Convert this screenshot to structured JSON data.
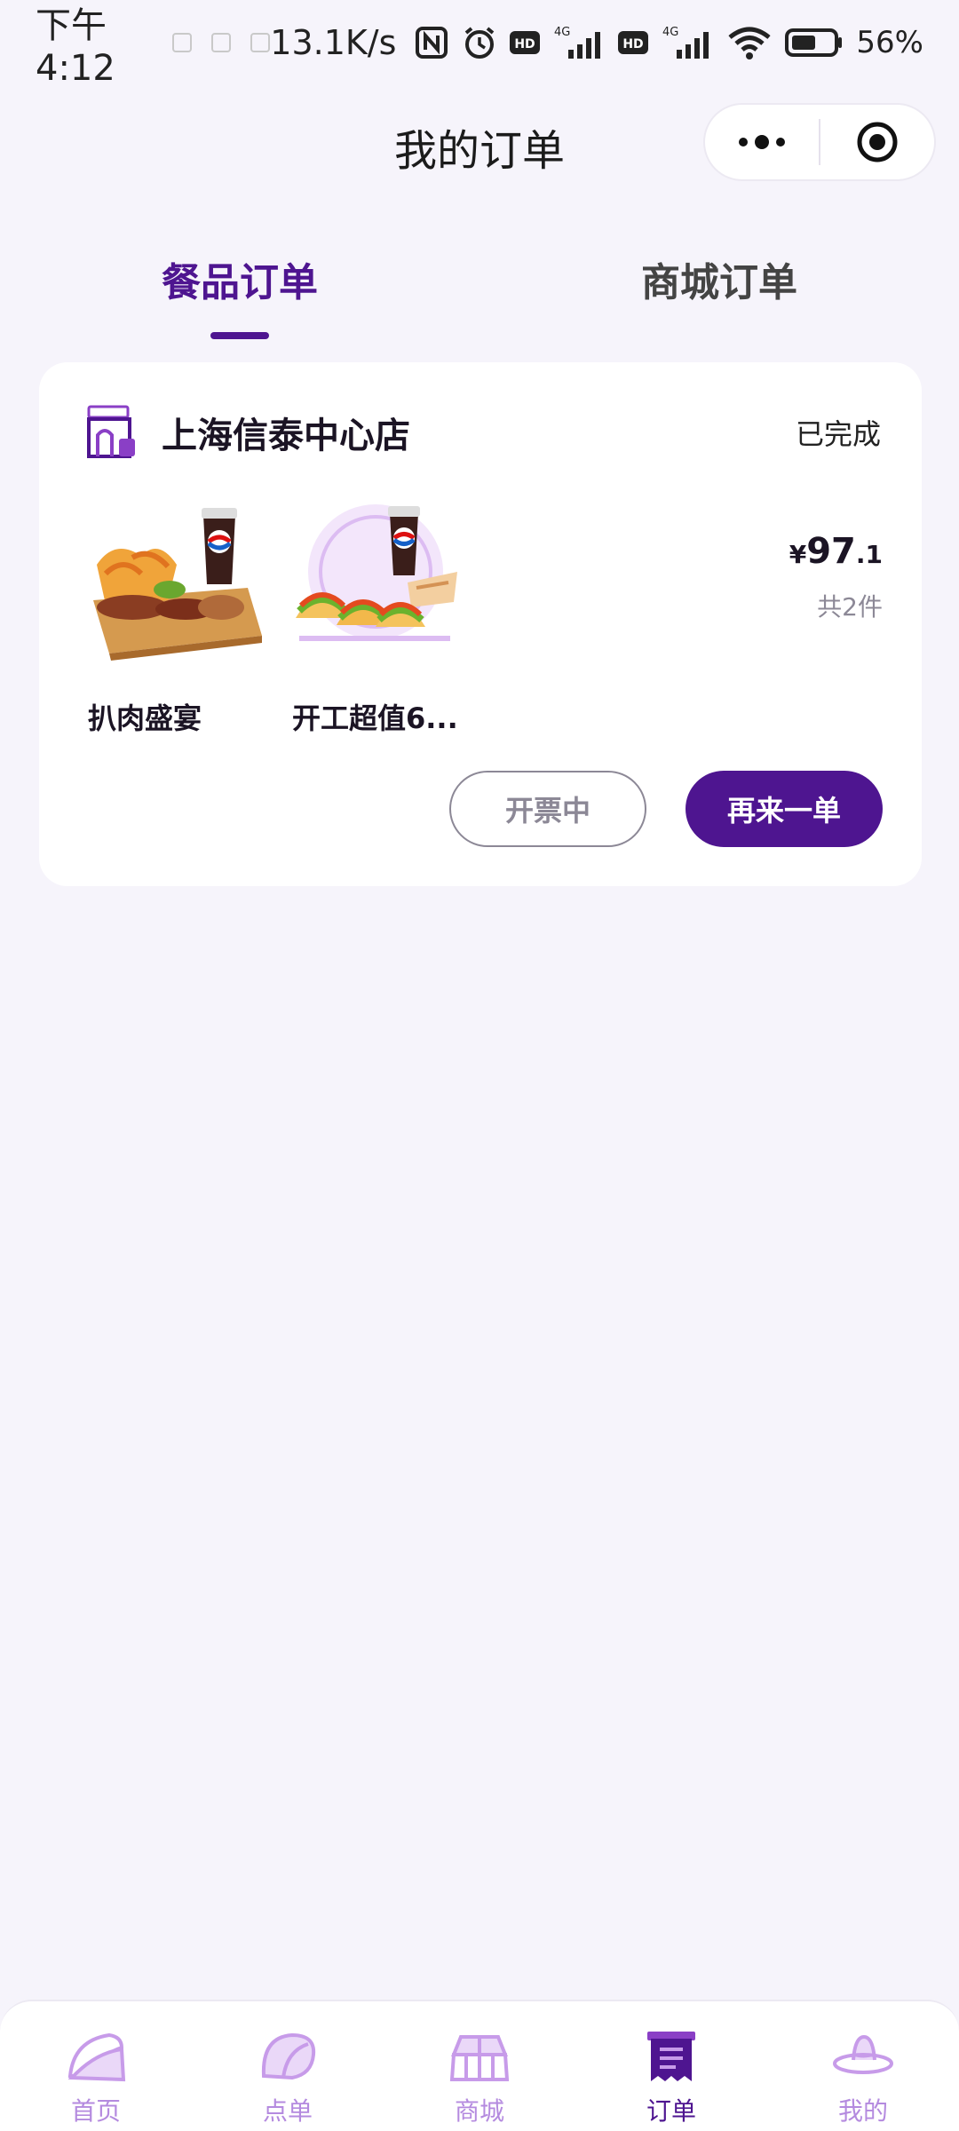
{
  "status_bar": {
    "time": "下午4:12",
    "net_speed": "13.1K/s",
    "battery": "56%",
    "network_1": "4G",
    "network_2": "4G",
    "hd_1": "HD",
    "hd_2": "HD"
  },
  "header": {
    "title": "我的订单"
  },
  "tabs": [
    {
      "label": "餐品订单",
      "active": true
    },
    {
      "label": "商城订单",
      "active": false
    }
  ],
  "order": {
    "store_name": "上海信泰中心店",
    "status": "已完成",
    "items": [
      {
        "name": "扒肉盛宴"
      },
      {
        "name": "开工超值6..."
      }
    ],
    "price_currency": "¥",
    "price_int": "97",
    "price_dec": ".1",
    "quantity": "共2件",
    "invoice_button": "开票中",
    "reorder_button": "再来一单"
  },
  "bottom_nav": [
    {
      "label": "首页",
      "icon": "taco-home-icon",
      "active": false
    },
    {
      "label": "点单",
      "icon": "taco-order-icon",
      "active": false
    },
    {
      "label": "商城",
      "icon": "temple-mall-icon",
      "active": false
    },
    {
      "label": "订单",
      "icon": "receipt-orders-icon",
      "active": true
    },
    {
      "label": "我的",
      "icon": "sombrero-profile-icon",
      "active": false
    }
  ],
  "colors": {
    "brand": "#4e1590",
    "nav_inactive": "#b48adf",
    "background": "#f6f4fb"
  }
}
